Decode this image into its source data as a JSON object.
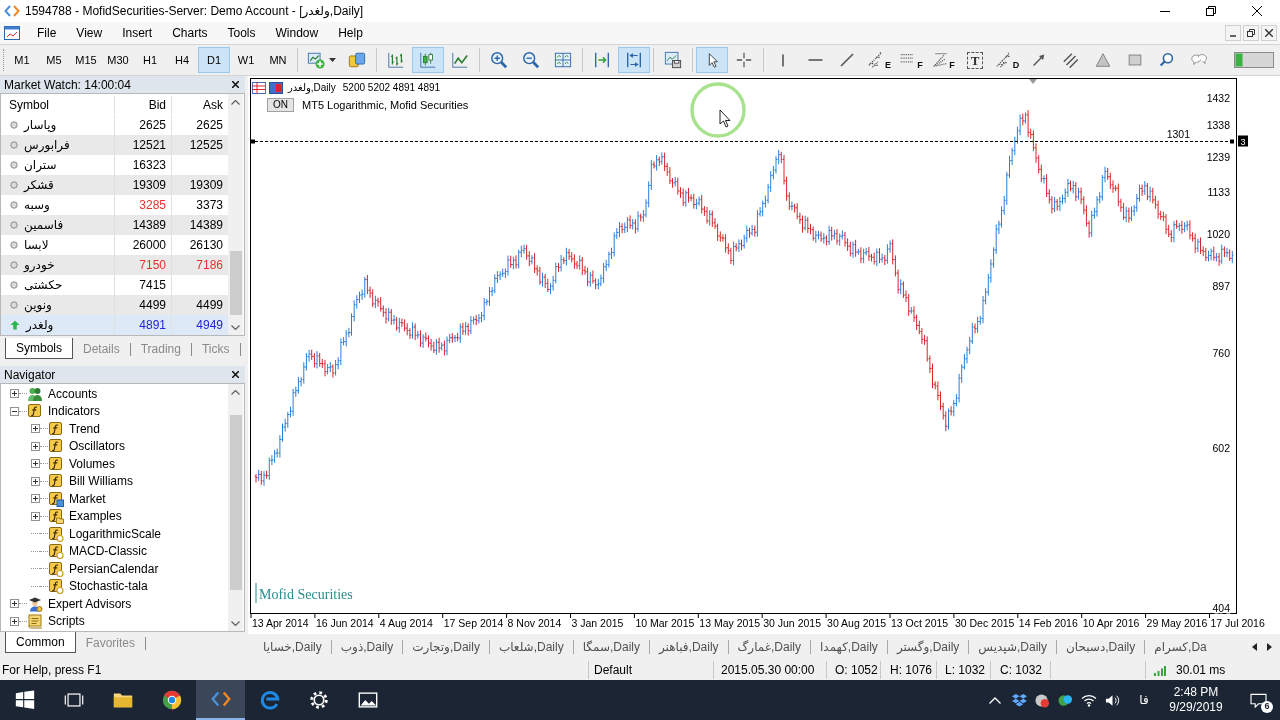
{
  "window": {
    "title": "1594788 - MofidSecurities-Server: Demo Account - [ولغدر,Daily]"
  },
  "menu": [
    "File",
    "View",
    "Insert",
    "Charts",
    "Tools",
    "Window",
    "Help"
  ],
  "timeframes": [
    {
      "label": "M1",
      "selected": false
    },
    {
      "label": "M5",
      "selected": false
    },
    {
      "label": "M15",
      "selected": false
    },
    {
      "label": "M30",
      "selected": false
    },
    {
      "label": "H1",
      "selected": false
    },
    {
      "label": "H4",
      "selected": false
    },
    {
      "label": "D1",
      "selected": true
    },
    {
      "label": "W1",
      "selected": false
    },
    {
      "label": "MN",
      "selected": false
    }
  ],
  "tool_groups": [
    [
      {
        "kind": "new_chart",
        "selected": false,
        "menu": true
      },
      {
        "kind": "market",
        "selected": false
      }
    ],
    [
      {
        "kind": "bar_chart",
        "selected": false
      },
      {
        "kind": "candlesticks",
        "selected": true
      },
      {
        "kind": "line_chart",
        "selected": false
      }
    ],
    [
      {
        "kind": "zoom_in",
        "selected": false
      },
      {
        "kind": "zoom_out",
        "selected": false
      },
      {
        "kind": "tile",
        "selected": false
      }
    ],
    [
      {
        "kind": "chart_shift",
        "selected": false
      },
      {
        "kind": "auto_scroll",
        "selected": true
      }
    ],
    [
      {
        "kind": "templates",
        "selected": false
      }
    ],
    [
      {
        "kind": "cursor",
        "selected": true
      },
      {
        "kind": "crosshair",
        "selected": false
      }
    ],
    [
      {
        "kind": "vertical_line",
        "selected": false
      },
      {
        "kind": "horizontal_line",
        "selected": false
      },
      {
        "kind": "trendline",
        "selected": false
      },
      {
        "kind": "channel",
        "selected": false,
        "letter": "E"
      },
      {
        "kind": "fibo",
        "selected": false,
        "letter": "F"
      },
      {
        "kind": "fibo_fan",
        "selected": false,
        "letter": "F"
      },
      {
        "kind": "text",
        "selected": false,
        "letter": "T"
      },
      {
        "kind": "pitchfork",
        "selected": false,
        "letter": "D"
      },
      {
        "kind": "arrow",
        "selected": false
      },
      {
        "kind": "parallel",
        "selected": false
      },
      {
        "kind": "triangle",
        "selected": false
      },
      {
        "kind": "rectangle",
        "selected": false
      },
      {
        "kind": "search",
        "selected": false
      },
      {
        "kind": "chat",
        "selected": false
      }
    ]
  ],
  "market_watch": {
    "title": "Market Watch: 14:00:04",
    "columns": [
      "Symbol",
      "Bid",
      "Ask"
    ],
    "rows": [
      {
        "kind": "dot",
        "symbol": "وپاسار",
        "bid": {
          "value": "2625",
          "color": "#000000"
        },
        "ask": {
          "value": "2625",
          "color": "#000000"
        },
        "selected": false
      },
      {
        "kind": "dot",
        "symbol": "فرابورس",
        "bid": {
          "value": "12521",
          "color": "#000000"
        },
        "ask": {
          "value": "12525",
          "color": "#000000"
        },
        "selected": false
      },
      {
        "kind": "dot",
        "symbol": "ستران",
        "bid": {
          "value": "16323",
          "color": "#000000"
        },
        "selected": false
      },
      {
        "kind": "dot",
        "symbol": "قشکر",
        "bid": {
          "value": "19309",
          "color": "#000000"
        },
        "ask": {
          "value": "19309",
          "color": "#000000"
        },
        "selected": false
      },
      {
        "kind": "dot",
        "symbol": "وسبه",
        "bid": {
          "value": "3285",
          "color": "#e5322d"
        },
        "ask": {
          "value": "3373",
          "color": "#000000"
        },
        "selected": false
      },
      {
        "kind": "dot",
        "symbol": "فاسمین",
        "bid": {
          "value": "14389",
          "color": "#000000"
        },
        "ask": {
          "value": "14389",
          "color": "#000000"
        },
        "selected": false
      },
      {
        "kind": "dot",
        "symbol": "لابسا",
        "bid": {
          "value": "26000",
          "color": "#000000"
        },
        "ask": {
          "value": "26130",
          "color": "#000000"
        },
        "selected": false
      },
      {
        "kind": "dot",
        "symbol": "خودرو",
        "bid": {
          "value": "7150",
          "color": "#e5322d"
        },
        "ask": {
          "value": "7186",
          "color": "#e5322d"
        },
        "selected": false
      },
      {
        "kind": "dot",
        "symbol": "حکشتی",
        "bid": {
          "value": "7415",
          "color": "#000000"
        },
        "selected": false
      },
      {
        "kind": "dot",
        "symbol": "ونوین",
        "bid": {
          "value": "4499",
          "color": "#000000"
        },
        "ask": {
          "value": "4499",
          "color": "#000000"
        },
        "selected": false
      },
      {
        "kind": "up",
        "symbol": "ولغدر",
        "bid": {
          "value": "4891",
          "color": "#2323d8"
        },
        "ask": {
          "value": "4949",
          "color": "#2323d8"
        },
        "selected": true
      }
    ],
    "tabs": [
      {
        "label": "Symbols",
        "selected": true
      },
      {
        "label": "Details",
        "selected": false
      },
      {
        "label": "Trading",
        "selected": false
      },
      {
        "label": "Ticks",
        "selected": false
      }
    ]
  },
  "navigator": {
    "title": "Navigator",
    "tree": [
      {
        "label": "Accounts",
        "kind": "accounts",
        "expanded": false
      },
      {
        "label": "Indicators",
        "kind": "indicators",
        "expanded": true,
        "children": [
          {
            "label": "Trend",
            "kind": "indicators",
            "expanded": false
          },
          {
            "label": "Oscillators",
            "kind": "indicators",
            "expanded": false
          },
          {
            "label": "Volumes",
            "kind": "indicators",
            "expanded": false
          },
          {
            "label": "Bill Williams",
            "kind": "indicators",
            "expanded": false
          },
          {
            "label": "Market",
            "kind": "market",
            "expanded": false
          },
          {
            "label": "Examples",
            "kind": "examples",
            "expanded": false
          },
          {
            "label": "LogarithmicScale",
            "kind": "custom"
          },
          {
            "label": "MACD-Classic",
            "kind": "custom"
          },
          {
            "label": "PersianCalendar",
            "kind": "custom"
          },
          {
            "label": "Stochastic-tala",
            "kind": "custom"
          }
        ]
      },
      {
        "label": "Expert Advisors",
        "kind": "experts",
        "expanded": false
      },
      {
        "label": "Scripts",
        "kind": "scripts",
        "expanded": false
      }
    ],
    "tabs": [
      {
        "label": "Common",
        "selected": true
      },
      {
        "label": "Favorites",
        "selected": false
      }
    ]
  },
  "chart": {
    "symbol": "ولغدر,Daily",
    "ohlc": "5200 5202 4891 4891",
    "indicator_button": "ON",
    "indicator_label": "MT5 Logarithmic, Mofid Securities",
    "price_labels": [
      "1432",
      "1338",
      "1239",
      "1133",
      "1020",
      "897",
      "760",
      "602",
      "404"
    ],
    "level_label": "1301",
    "axis_badge": "3",
    "chart_label": "Mofid Securities",
    "date_labels": [
      "13 Apr 2014",
      "16 Jun 2014",
      "4 Aug 2014",
      "17 Sep 2014",
      "8 Nov 2014",
      "3 Jan 2015",
      "10 Mar 2015",
      "13 May 2015",
      "30 Jun 2015",
      "30 Aug 2015",
      "13 Oct 2015",
      "30 Dec 2015",
      "14 Feb 2016",
      "10 Apr 2016",
      "29 May 2016",
      "17 Jul 2016"
    ]
  },
  "chart_tabs": [
    {
      "label": "خسایا,Daily"
    },
    {
      "label": "ذوب,Daily"
    },
    {
      "label": "وتجارت,Daily"
    },
    {
      "label": "شلعاب,Daily"
    },
    {
      "label": "سمگا,Daily"
    },
    {
      "label": "فباهنر,Daily"
    },
    {
      "label": "غمارگ,Daily"
    },
    {
      "label": "کهمدا,Daily"
    },
    {
      "label": "وگستر,Daily"
    },
    {
      "label": "شپدیس,Daily"
    },
    {
      "label": "دسبحان,Daily"
    },
    {
      "label": "کسرام,Da"
    }
  ],
  "status_bar": {
    "help": "For Help, press F1",
    "profile": "Default",
    "datetime": "2015.05.30 00:00",
    "open": "O: 1052",
    "high": "H: 1076",
    "low": "L: 1032",
    "close": "C: 1032",
    "ping": "30.01 ms"
  },
  "taskbar": {
    "apps": [
      {
        "kind": "start",
        "active": false
      },
      {
        "kind": "task_view",
        "active": false
      },
      {
        "kind": "explorer",
        "active": false
      },
      {
        "kind": "browser",
        "active": false
      },
      {
        "kind": "terminal",
        "active": true
      },
      {
        "kind": "edge",
        "active": false
      },
      {
        "kind": "settings",
        "active": false
      },
      {
        "kind": "photos",
        "active": false
      }
    ],
    "tray": {
      "language": "فا",
      "time": "2:48 PM",
      "date": "9/29/2019",
      "notifications": "6"
    }
  }
}
